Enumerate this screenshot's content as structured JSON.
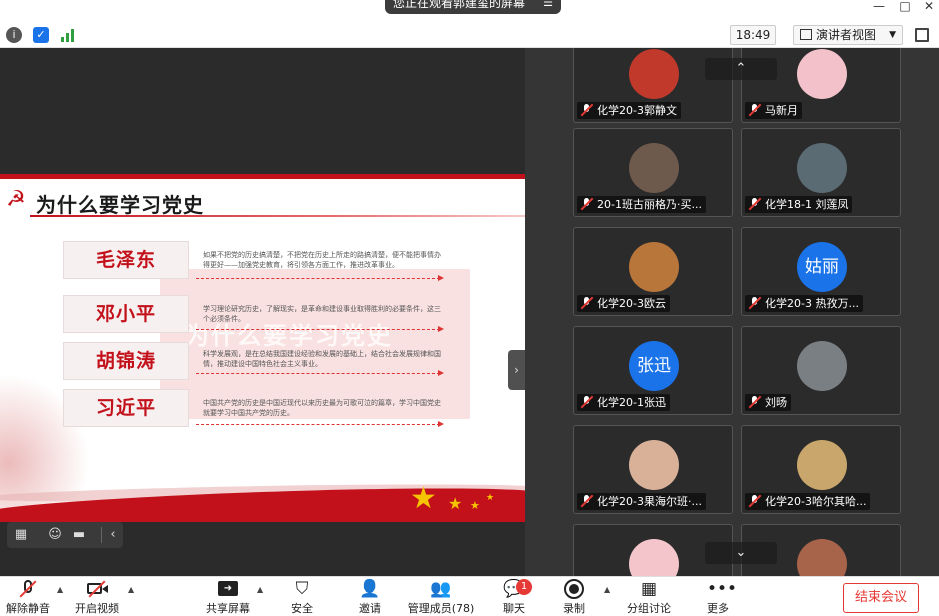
{
  "window": {
    "share_banner": "您正在观看郭建玺的屏幕",
    "banner_menu": "☰",
    "minimize": "—",
    "maximize": "□",
    "close": "✕"
  },
  "topbar": {
    "time": "18:49",
    "view_mode": "演讲者视图",
    "view_caret": "▼"
  },
  "slide": {
    "title": "为什么要学习党史",
    "bg_text": "为什么要学习党史",
    "leaders": [
      {
        "name": "毛泽东",
        "desc": "如果不把党的历史搞清楚，不把党在历史上所走的路搞清楚，便不能把事情办得更好——加强党史教育，将引领各方面工作，推进改革事业。"
      },
      {
        "name": "邓小平",
        "desc": "学习理论研究历史，了解现实，是革命和建设事业取得胜利的必要条件，这三个必须条件。"
      },
      {
        "name": "胡锦涛",
        "desc": "科学发展观，是在总结我国建设经验和发展的基础上，结合社会发展规律和国情，推动建设中国特色社会主义事业。"
      },
      {
        "name": "习近平",
        "desc": "中国共产党的历史是中国近现代以来历史最为可歌可泣的篇章，学习中国党史就要学习中国共产党的历史。"
      }
    ]
  },
  "left_toolbar": {
    "collapse": "‹"
  },
  "collapse_handle": "›",
  "gallery": {
    "up_arrow": "⌃",
    "down_arrow": "⌄",
    "tiles": [
      {
        "name": "化学20-3郭静文",
        "avatar_text": "",
        "avatar_color": "#c0392b"
      },
      {
        "name": "马新月",
        "avatar_text": "",
        "avatar_color": "#f2c1c9"
      },
      {
        "name": "20-1班古丽格乃·买...",
        "avatar_text": "",
        "avatar_color": "#6d5a4c"
      },
      {
        "name": "化学18-1 刘莲凤",
        "avatar_text": "",
        "avatar_color": "#5b6b74"
      },
      {
        "name": "化学20-3欧云",
        "avatar_text": "",
        "avatar_color": "#b8763a"
      },
      {
        "name": "化学20-3 热孜万...",
        "avatar_text": "姑丽",
        "avatar_color": "#1a73e8"
      },
      {
        "name": "化学20-1张迅",
        "avatar_text": "张迅",
        "avatar_color": "#1a73e8"
      },
      {
        "name": "刘旸",
        "avatar_text": "",
        "avatar_color": "#7a7f84"
      },
      {
        "name": "化学20-3果海尔班·...",
        "avatar_text": "",
        "avatar_color": "#d9b199"
      },
      {
        "name": "化学20-3哈尔其哈...",
        "avatar_text": "",
        "avatar_color": "#c9a66b"
      },
      {
        "name": "",
        "avatar_text": "",
        "avatar_color": "#f4c6cc"
      },
      {
        "name": "",
        "avatar_text": "",
        "avatar_color": "#a8644a"
      }
    ]
  },
  "bottombar": {
    "unmute": "解除静音",
    "start_video": "开启视频",
    "share_screen": "共享屏幕",
    "security": "安全",
    "invite": "邀请",
    "participants": "管理成员(78)",
    "chat": "聊天",
    "chat_badge": "1",
    "record": "录制",
    "breakout": "分组讨论",
    "more": "更多",
    "end": "结束会议"
  },
  "colors": {
    "accent_red": "#c3111b",
    "avatar_blue": "#1a73e8",
    "end_red": "#e53935"
  }
}
